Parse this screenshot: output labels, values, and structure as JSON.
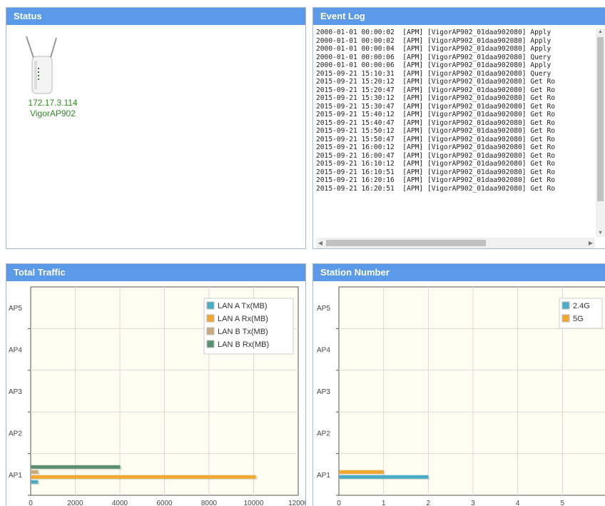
{
  "status": {
    "title": "Status",
    "device": {
      "ip": "172.17.3.114",
      "name": "VigorAP902"
    }
  },
  "event_log": {
    "title": "Event Log",
    "lines": [
      "2000-01-01 00:00:02  [APM] [VigorAP902_01daa902080] Apply",
      "2000-01-01 00:00:02  [APM] [VigorAP902_01daa902080] Apply",
      "2000-01-01 00:00:04  [APM] [VigorAP902_01daa902080] Apply",
      "2000-01-01 00:00:06  [APM] [VigorAP902_01daa902080] Query",
      "2000-01-01 00:00:06  [APM] [VigorAP902_01daa902080] Apply",
      "2015-09-21 15:10:31  [APM] [VigorAP902_01daa902080] Query",
      "2015-09-21 15:20:12  [APM] [VigorAP902_01daa902080] Get Ro",
      "2015-09-21 15:20:47  [APM] [VigorAP902_01daa902080] Get Ro",
      "2015-09-21 15:30:12  [APM] [VigorAP902_01daa902080] Get Ro",
      "2015-09-21 15:30:47  [APM] [VigorAP902_01daa902080] Get Ro",
      "2015-09-21 15:40:12  [APM] [VigorAP902_01daa902080] Get Ro",
      "2015-09-21 15:40:47  [APM] [VigorAP902_01daa902080] Get Ro",
      "2015-09-21 15:50:12  [APM] [VigorAP902_01daa902080] Get Ro",
      "2015-09-21 15:50:47  [APM] [VigorAP902_01daa902080] Get Ro",
      "2015-09-21 16:00:12  [APM] [VigorAP902_01daa902080] Get Ro",
      "2015-09-21 16:00:47  [APM] [VigorAP902_01daa902080] Get Ro",
      "2015-09-21 16:10:12  [APM] [VigorAP902_01daa902080] Get Ro",
      "2015-09-21 16:10:51  [APM] [VigorAP902_01daa902080] Get Ro",
      "2015-09-21 16:20:16  [APM] [VigorAP902_01daa902080] Get Ro",
      "2015-09-21 16:20:51  [APM] [VigorAP902_01daa902080] Get Ro"
    ]
  },
  "total_traffic": {
    "title": "Total Traffic"
  },
  "station_number": {
    "title": "Station Number"
  },
  "chart_data": [
    {
      "type": "bar",
      "orientation": "horizontal",
      "categories": [
        "AP1",
        "AP2",
        "AP3",
        "AP4",
        "AP5"
      ],
      "series": [
        {
          "name": "LAN A Tx(MB)",
          "color": "#4bacc6",
          "values": [
            330,
            0,
            0,
            0,
            0
          ]
        },
        {
          "name": "LAN A Rx(MB)",
          "color": "#f0a830",
          "values": [
            10100,
            0,
            0,
            0,
            0
          ]
        },
        {
          "name": "LAN B Tx(MB)",
          "color": "#c8aa80",
          "values": [
            340,
            0,
            0,
            0,
            0
          ]
        },
        {
          "name": "LAN B Rx(MB)",
          "color": "#5a9070",
          "values": [
            4020,
            0,
            0,
            0,
            0
          ]
        }
      ],
      "xlim": [
        0,
        12000
      ],
      "xticks": [
        "0",
        "2000",
        "4000",
        "6000",
        "8000",
        "10000",
        "12000"
      ],
      "legend": "top-right",
      "grid": true,
      "background": "#fffdf2"
    },
    {
      "type": "bar",
      "orientation": "horizontal",
      "categories": [
        "AP1",
        "AP2",
        "AP3",
        "AP4",
        "AP5"
      ],
      "series": [
        {
          "name": "2.4G",
          "color": "#4bacc6",
          "values": [
            2,
            0,
            0,
            0,
            0
          ]
        },
        {
          "name": "5G",
          "color": "#f0a830",
          "values": [
            1,
            0,
            0,
            0,
            0
          ]
        }
      ],
      "xlim": [
        0,
        6
      ],
      "xticks": [
        "0",
        "1",
        "2",
        "3",
        "4",
        "5",
        "6"
      ],
      "legend": "top-right",
      "grid": true,
      "background": "#fffdf2"
    }
  ]
}
